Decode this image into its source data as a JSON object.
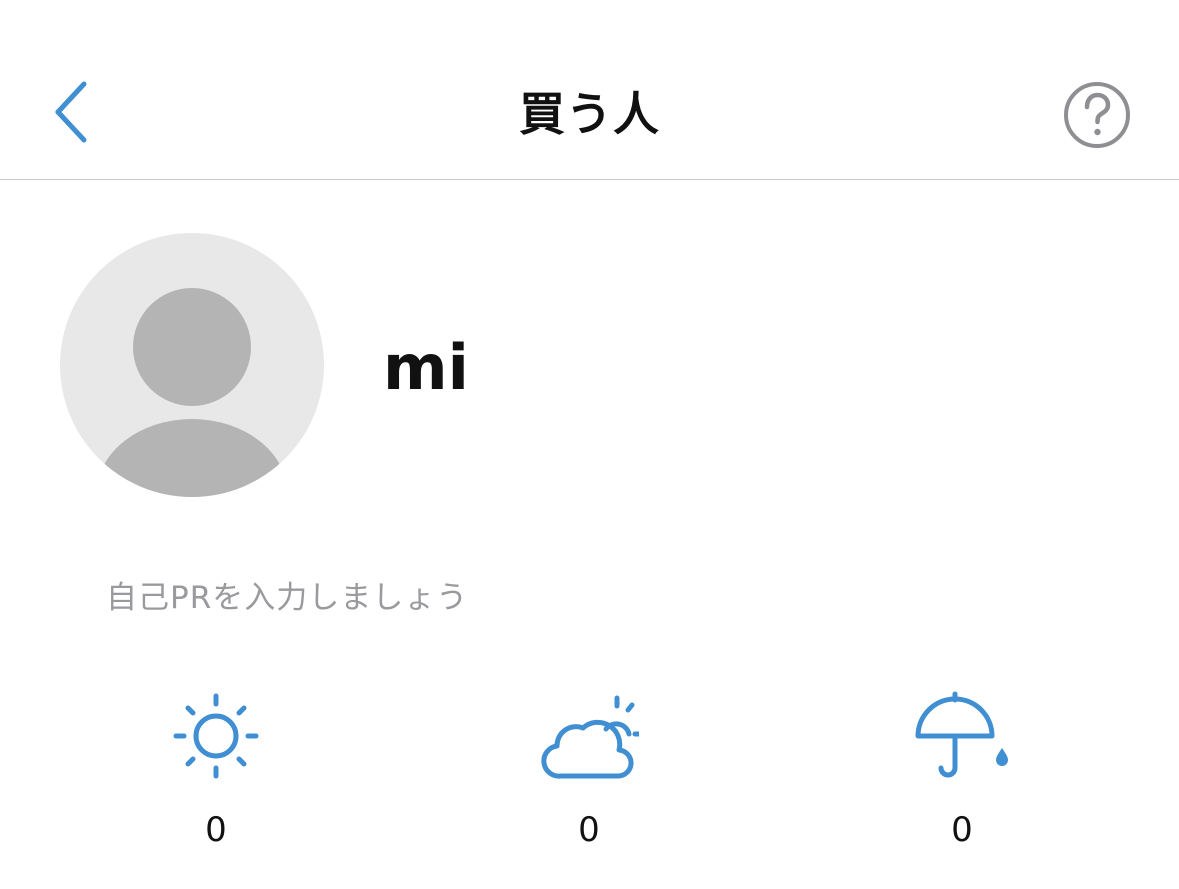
{
  "header": {
    "title": "買う人"
  },
  "profile": {
    "name": "mi",
    "pr_placeholder": "自己PRを入力しましょう"
  },
  "ratings": [
    {
      "icon": "sun-icon",
      "count": "0"
    },
    {
      "icon": "cloud-sun-icon",
      "count": "0"
    },
    {
      "icon": "umbrella-icon",
      "count": "0"
    }
  ],
  "colors": {
    "accent": "#3f8fd2",
    "avatar_bg": "#e8e8e8",
    "avatar_figure": "#b4b4b4",
    "help_icon": "#8e8e93",
    "divider": "#c8c8cc"
  }
}
